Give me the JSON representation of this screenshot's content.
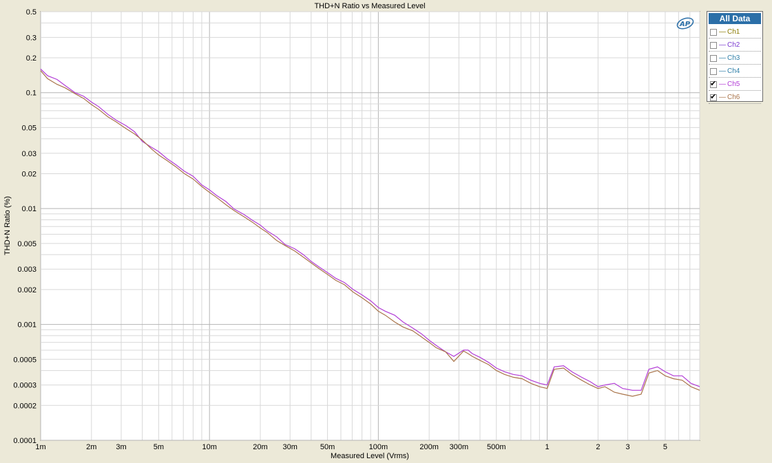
{
  "chart_data": {
    "type": "line",
    "title": "THD+N Ratio vs Measured Level",
    "xlabel": "Measured Level (Vrms)",
    "ylabel": "THD+N Ratio (%)",
    "xscale": "log",
    "yscale": "log",
    "xlim": [
      0.001,
      8.0
    ],
    "ylim": [
      0.0001,
      0.5
    ],
    "grid": true,
    "legend_position": "right",
    "x_ticks": [
      {
        "value": 0.001,
        "label": "1m"
      },
      {
        "value": 0.002,
        "label": "2m"
      },
      {
        "value": 0.003,
        "label": "3m"
      },
      {
        "value": 0.005,
        "label": "5m"
      },
      {
        "value": 0.01,
        "label": "10m"
      },
      {
        "value": 0.02,
        "label": "20m"
      },
      {
        "value": 0.03,
        "label": "30m"
      },
      {
        "value": 0.05,
        "label": "50m"
      },
      {
        "value": 0.1,
        "label": "100m"
      },
      {
        "value": 0.2,
        "label": "200m"
      },
      {
        "value": 0.3,
        "label": "300m"
      },
      {
        "value": 0.5,
        "label": "500m"
      },
      {
        "value": 1,
        "label": "1"
      },
      {
        "value": 2,
        "label": "2"
      },
      {
        "value": 3,
        "label": "3"
      },
      {
        "value": 5,
        "label": "5"
      }
    ],
    "y_ticks": [
      {
        "value": 0.5,
        "label": "0.5"
      },
      {
        "value": 0.3,
        "label": "0.3"
      },
      {
        "value": 0.2,
        "label": "0.2"
      },
      {
        "value": 0.1,
        "label": "0.1"
      },
      {
        "value": 0.05,
        "label": "0.05"
      },
      {
        "value": 0.03,
        "label": "0.03"
      },
      {
        "value": 0.02,
        "label": "0.02"
      },
      {
        "value": 0.01,
        "label": "0.01"
      },
      {
        "value": 0.005,
        "label": "0.005"
      },
      {
        "value": 0.003,
        "label": "0.003"
      },
      {
        "value": 0.002,
        "label": "0.002"
      },
      {
        "value": 0.001,
        "label": "0.001"
      },
      {
        "value": 0.0005,
        "label": "0.0005"
      },
      {
        "value": 0.0003,
        "label": "0.0003"
      },
      {
        "value": 0.0002,
        "label": "0.0002"
      },
      {
        "value": 0.0001,
        "label": "0.0001"
      }
    ],
    "series": [
      {
        "name": "Ch5",
        "color": "#b23cd6",
        "x": [
          0.001,
          0.0011,
          0.00125,
          0.0014,
          0.0016,
          0.0018,
          0.002,
          0.0022,
          0.0025,
          0.0028,
          0.0032,
          0.0036,
          0.004,
          0.0045,
          0.005,
          0.0056,
          0.0063,
          0.0071,
          0.008,
          0.009,
          0.01,
          0.011,
          0.0125,
          0.014,
          0.016,
          0.018,
          0.02,
          0.022,
          0.025,
          0.028,
          0.032,
          0.036,
          0.04,
          0.045,
          0.05,
          0.056,
          0.063,
          0.071,
          0.08,
          0.09,
          0.1,
          0.11,
          0.125,
          0.14,
          0.16,
          0.18,
          0.2,
          0.22,
          0.25,
          0.28,
          0.32,
          0.34,
          0.36,
          0.4,
          0.45,
          0.5,
          0.56,
          0.63,
          0.71,
          0.8,
          0.9,
          1.0,
          1.1,
          1.25,
          1.4,
          1.6,
          1.8,
          2.0,
          2.2,
          2.5,
          2.8,
          3.2,
          3.6,
          4.0,
          4.5,
          5.0,
          5.6,
          6.3,
          7.1,
          8.0
        ],
        "y": [
          0.16,
          0.14,
          0.13,
          0.115,
          0.1,
          0.093,
          0.083,
          0.076,
          0.065,
          0.058,
          0.052,
          0.046,
          0.038,
          0.034,
          0.031,
          0.027,
          0.024,
          0.021,
          0.019,
          0.016,
          0.0145,
          0.013,
          0.0115,
          0.0099,
          0.0089,
          0.0079,
          0.0072,
          0.0064,
          0.0057,
          0.0049,
          0.0045,
          0.004,
          0.0035,
          0.0031,
          0.0028,
          0.0025,
          0.0023,
          0.002,
          0.0018,
          0.0016,
          0.0014,
          0.0013,
          0.0012,
          0.00105,
          0.00093,
          0.00083,
          0.00073,
          0.00066,
          0.00058,
          0.00053,
          0.0006,
          0.0006,
          0.00056,
          0.00052,
          0.00047,
          0.00042,
          0.00039,
          0.00037,
          0.00036,
          0.00033,
          0.00031,
          0.0003,
          0.00043,
          0.00044,
          0.00039,
          0.00035,
          0.00032,
          0.00029,
          0.0003,
          0.00031,
          0.00028,
          0.00027,
          0.00027,
          0.00041,
          0.00043,
          0.00039,
          0.00036,
          0.00036,
          0.00031,
          0.00029
        ]
      },
      {
        "name": "Ch6",
        "color": "#a9744a",
        "x": [
          0.001,
          0.0011,
          0.00125,
          0.0014,
          0.0016,
          0.0018,
          0.002,
          0.0022,
          0.0025,
          0.0028,
          0.0032,
          0.0036,
          0.004,
          0.0045,
          0.005,
          0.0056,
          0.0063,
          0.0071,
          0.008,
          0.009,
          0.01,
          0.011,
          0.0125,
          0.014,
          0.016,
          0.018,
          0.02,
          0.022,
          0.025,
          0.028,
          0.032,
          0.036,
          0.04,
          0.045,
          0.05,
          0.056,
          0.063,
          0.071,
          0.08,
          0.09,
          0.1,
          0.11,
          0.125,
          0.14,
          0.16,
          0.18,
          0.2,
          0.22,
          0.25,
          0.28,
          0.32,
          0.34,
          0.36,
          0.4,
          0.45,
          0.5,
          0.56,
          0.63,
          0.71,
          0.8,
          0.9,
          1.0,
          1.1,
          1.25,
          1.4,
          1.6,
          1.8,
          2.0,
          2.2,
          2.5,
          2.8,
          3.2,
          3.6,
          4.0,
          4.5,
          5.0,
          5.6,
          6.3,
          7.1,
          8.0
        ],
        "y": [
          0.155,
          0.132,
          0.118,
          0.11,
          0.098,
          0.089,
          0.079,
          0.072,
          0.062,
          0.056,
          0.049,
          0.044,
          0.039,
          0.033,
          0.029,
          0.026,
          0.023,
          0.02,
          0.018,
          0.0155,
          0.0138,
          0.0125,
          0.0108,
          0.0096,
          0.0085,
          0.0076,
          0.0068,
          0.0062,
          0.0053,
          0.0048,
          0.0043,
          0.0038,
          0.0034,
          0.003,
          0.0027,
          0.0024,
          0.0022,
          0.0019,
          0.0017,
          0.0015,
          0.0013,
          0.0012,
          0.00105,
          0.00095,
          0.00088,
          0.00078,
          0.0007,
          0.00063,
          0.00058,
          0.00048,
          0.00059,
          0.00056,
          0.00053,
          0.00049,
          0.00045,
          0.0004,
          0.00037,
          0.00035,
          0.00034,
          0.00031,
          0.00029,
          0.00028,
          0.00041,
          0.00042,
          0.00037,
          0.00033,
          0.0003,
          0.00028,
          0.00029,
          0.00026,
          0.00025,
          0.00024,
          0.00025,
          0.00038,
          0.0004,
          0.00036,
          0.00034,
          0.00033,
          0.00029,
          0.00027
        ]
      }
    ]
  },
  "legend": {
    "header": "All Data",
    "items": [
      {
        "label": "Ch1",
        "checked": false,
        "color": "#8a7a00"
      },
      {
        "label": "Ch2",
        "checked": false,
        "color": "#7a3ad0"
      },
      {
        "label": "Ch3",
        "checked": false,
        "color": "#2f7fa8"
      },
      {
        "label": "Ch4",
        "checked": false,
        "color": "#2f7fa8"
      },
      {
        "label": "Ch5",
        "checked": true,
        "color": "#b23cd6"
      },
      {
        "label": "Ch6",
        "checked": true,
        "color": "#a9744a"
      }
    ]
  },
  "logo_text": "AP"
}
